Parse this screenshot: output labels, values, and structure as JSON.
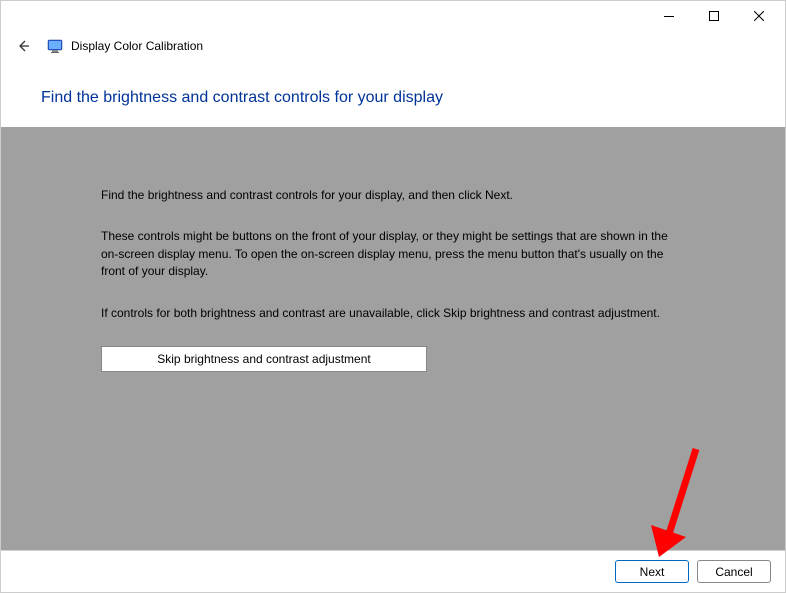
{
  "window": {
    "app_title": "Display Color Calibration"
  },
  "heading": "Find the brightness and contrast controls for your display",
  "body": {
    "p1": "Find the brightness and contrast controls for your display, and then click Next.",
    "p2": "These controls might be buttons on the front of your display, or they might be settings that are shown in the on-screen display menu. To open the on-screen display menu, press the menu button that's usually on the front of your display.",
    "p3": "If controls for both brightness and contrast are unavailable, click Skip brightness and contrast adjustment.",
    "skip_label": "Skip brightness and contrast adjustment"
  },
  "footer": {
    "next_label": "Next",
    "cancel_label": "Cancel"
  }
}
